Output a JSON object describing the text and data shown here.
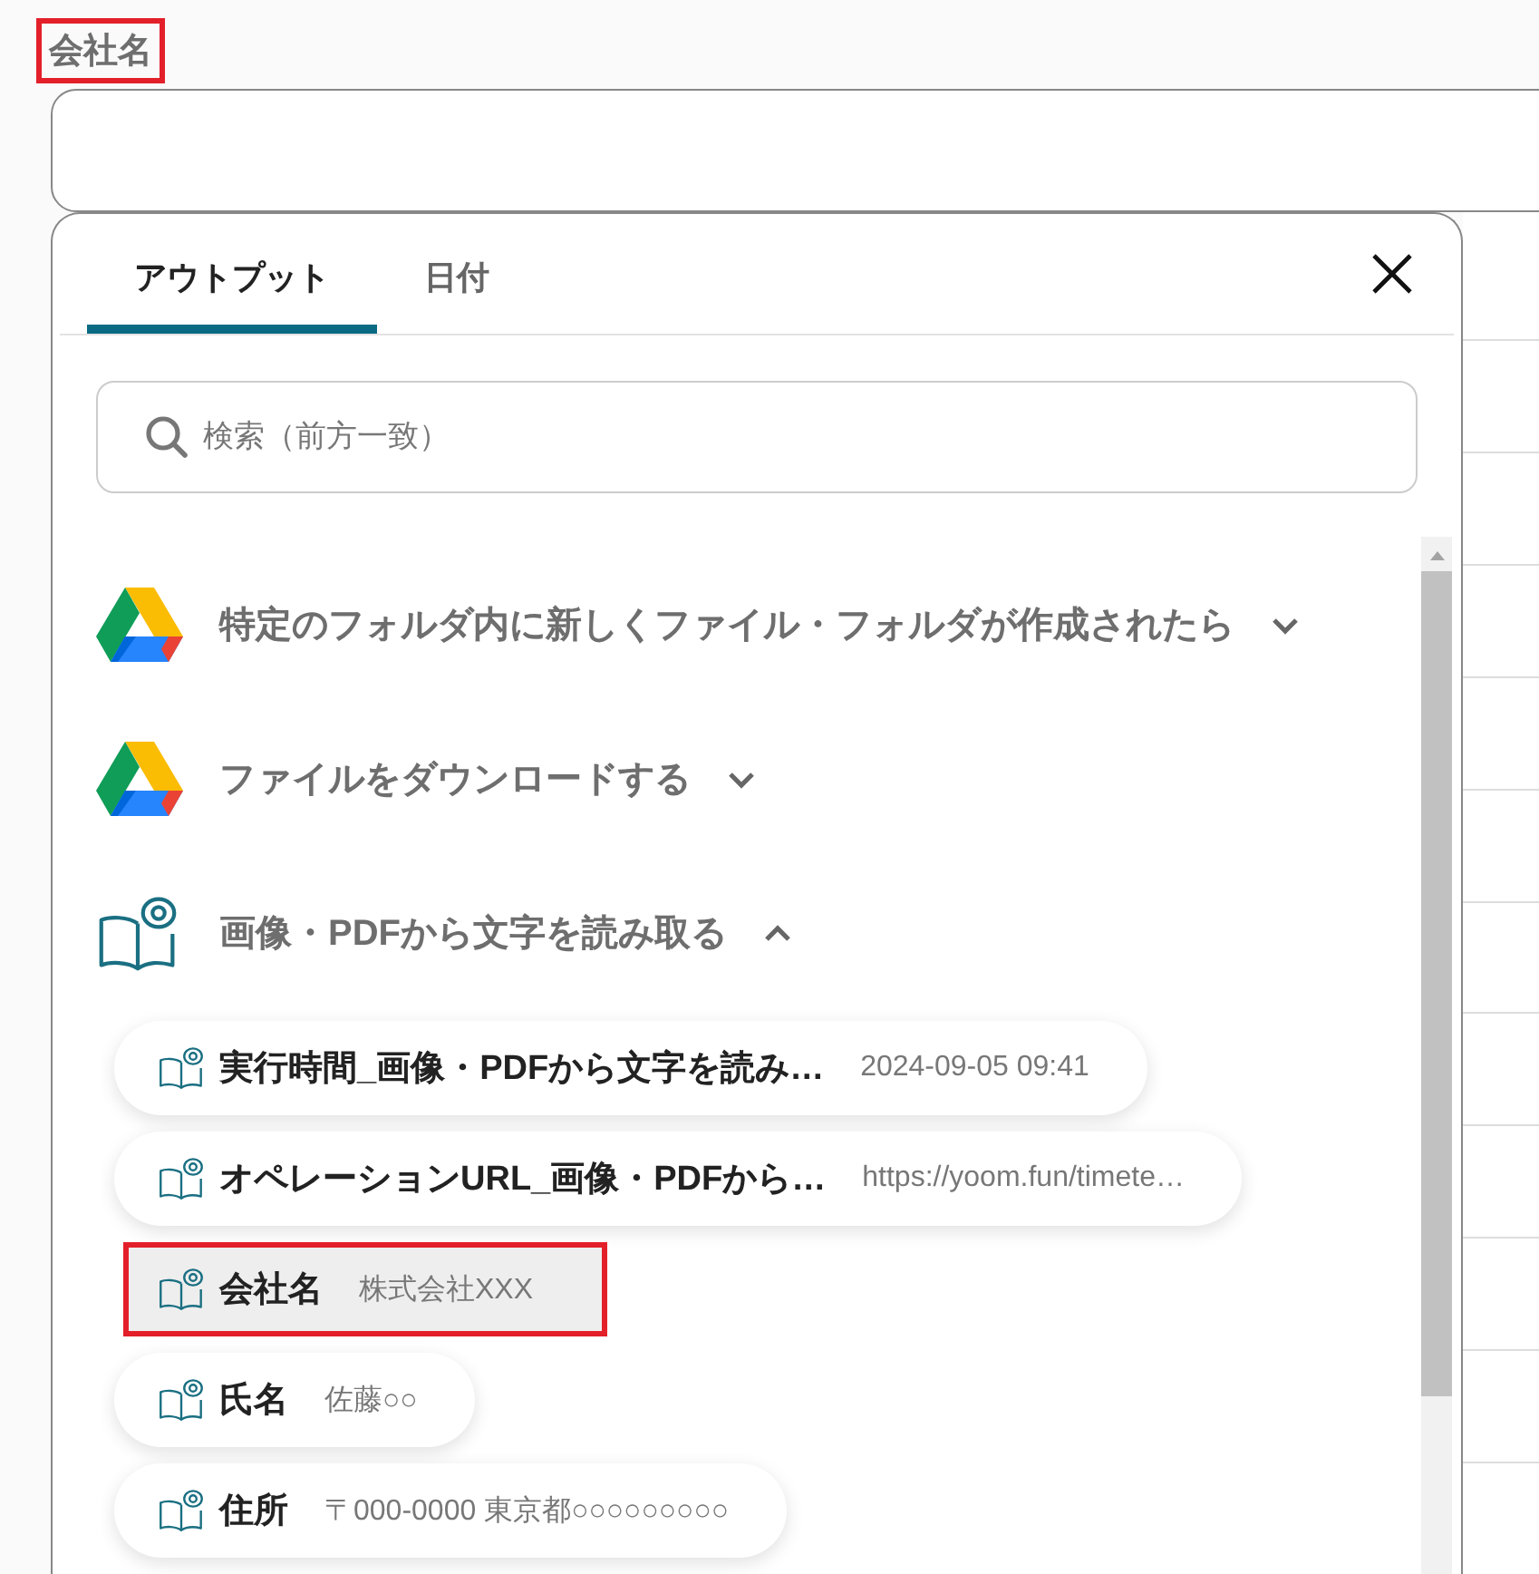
{
  "field": {
    "label": "会社名",
    "highlighted": true
  },
  "popup": {
    "tabs": [
      {
        "label": "アウトプット",
        "selected": true
      },
      {
        "label": "日付",
        "selected": false
      }
    ],
    "search": {
      "placeholder": "検索（前方一致）"
    },
    "groups": [
      {
        "kind": "drive",
        "title": "特定のフォルダ内に新しくファイル・フォルダが作成されたら",
        "expanded": false
      },
      {
        "kind": "drive",
        "title": "ファイルをダウンロードする",
        "expanded": false
      },
      {
        "kind": "ocr",
        "title": "画像・PDFから文字を読み取る",
        "expanded": true,
        "items": [
          {
            "label": "実行時間_画像・PDFから文字を読み…",
            "value": "2024-09-05 09:41",
            "highlighted": false
          },
          {
            "label": "オペレーションURL_画像・PDFから…",
            "value": "https://yoom.fun/timete…",
            "highlighted": false
          },
          {
            "label": "会社名",
            "value": "株式会社XXX",
            "highlighted": true
          },
          {
            "label": "氏名",
            "value": "佐藤○○",
            "highlighted": false
          },
          {
            "label": "住所",
            "value": "〒000-0000 東京都○○○○○○○○○",
            "highlighted": false
          }
        ]
      }
    ]
  }
}
